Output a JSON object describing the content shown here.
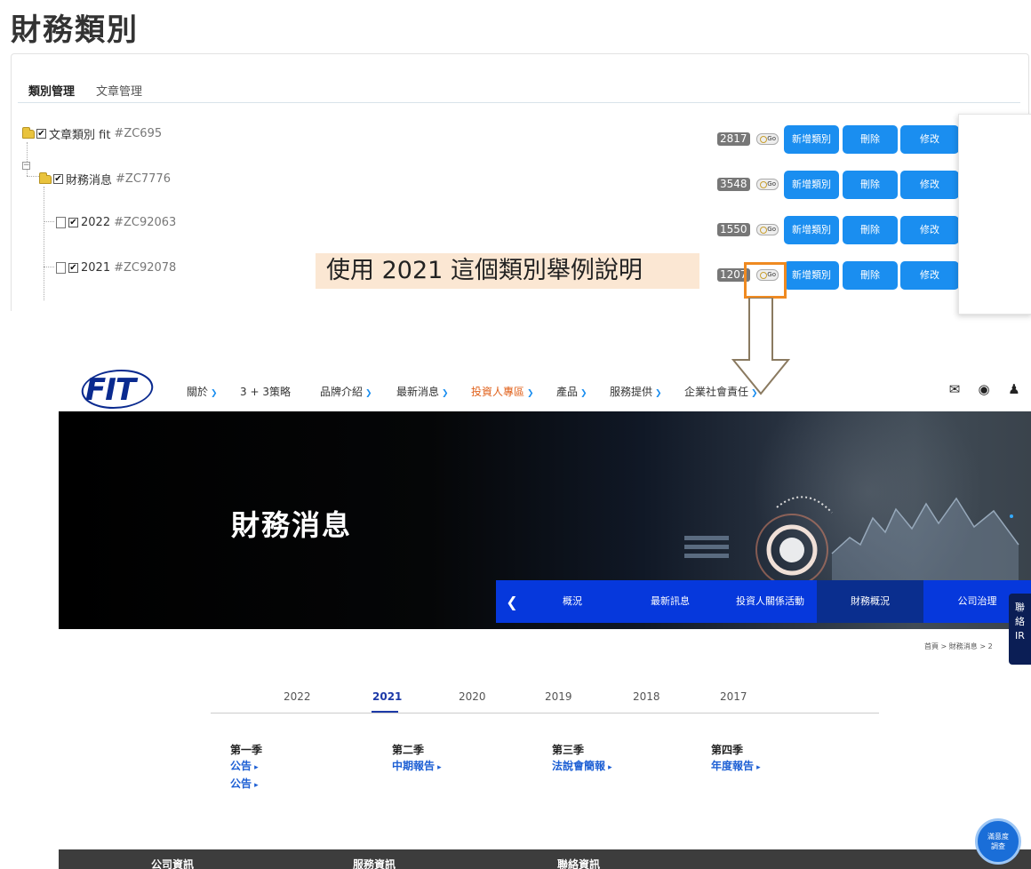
{
  "page": {
    "title": "財務類別"
  },
  "admin": {
    "tabs": [
      "類別管理",
      "文章管理"
    ],
    "tree": [
      {
        "name": "文章類別 fit",
        "code": "#ZC695",
        "count": "2817"
      },
      {
        "name": "財務消息",
        "code": "#ZC7776",
        "count": "3548"
      },
      {
        "name": "2022",
        "code": "#ZC92063",
        "count": "1550"
      },
      {
        "name": "2021",
        "code": "#ZC92078",
        "count": "1207"
      }
    ],
    "buttons": {
      "go": "Go",
      "add": "新增類別",
      "delete": "刪除",
      "edit": "修改"
    },
    "check_mark": "✔",
    "collapse_mark": "−"
  },
  "annotation": {
    "text": "使用 2021 這個類別舉例說明",
    "highlight_color": "#ef8a21"
  },
  "site": {
    "logo": "FIT",
    "nav": [
      {
        "label": "關於",
        "chevron": true
      },
      {
        "label": "3 + 3策略",
        "chevron": false
      },
      {
        "label": "品牌介紹",
        "chevron": true
      },
      {
        "label": "最新消息",
        "chevron": true
      },
      {
        "label": "投資人專區",
        "chevron": true,
        "active": true
      },
      {
        "label": "產品",
        "chevron": true
      },
      {
        "label": "服務提供",
        "chevron": true
      },
      {
        "label": "企業社會責任",
        "chevron": true
      }
    ],
    "nav_icons": [
      "mail-icon",
      "globe-icon",
      "user-icon"
    ],
    "hero": {
      "title": "財務消息",
      "subnav": [
        "概況",
        "最新訊息",
        "投資人關係活動",
        "財務概況",
        "公司治理"
      ],
      "subnav_selected": "財務概況"
    },
    "ir_tab": [
      "聯",
      "絡",
      "IR"
    ],
    "breadcrumb": "首頁 > 財務消息 > 2",
    "years": [
      "2022",
      "2021",
      "2020",
      "2019",
      "2018",
      "2017"
    ],
    "selected_year": "2021",
    "quarters": [
      {
        "title": "第一季",
        "links": [
          "公告",
          "公告"
        ]
      },
      {
        "title": "第二季",
        "links": [
          "中期報告"
        ]
      },
      {
        "title": "第三季",
        "links": [
          "法說會簡報"
        ]
      },
      {
        "title": "第四季",
        "links": [
          "年度報告"
        ]
      }
    ],
    "footer": [
      "公司資訊",
      "服務資訊",
      "聯絡資訊"
    ],
    "survey": [
      "滿意度",
      "調查"
    ],
    "colors": {
      "brand": "#0a2a8f",
      "accent": "#1a8ef0",
      "active_nav": "#e0611b",
      "subnav": "#0638dc"
    }
  }
}
